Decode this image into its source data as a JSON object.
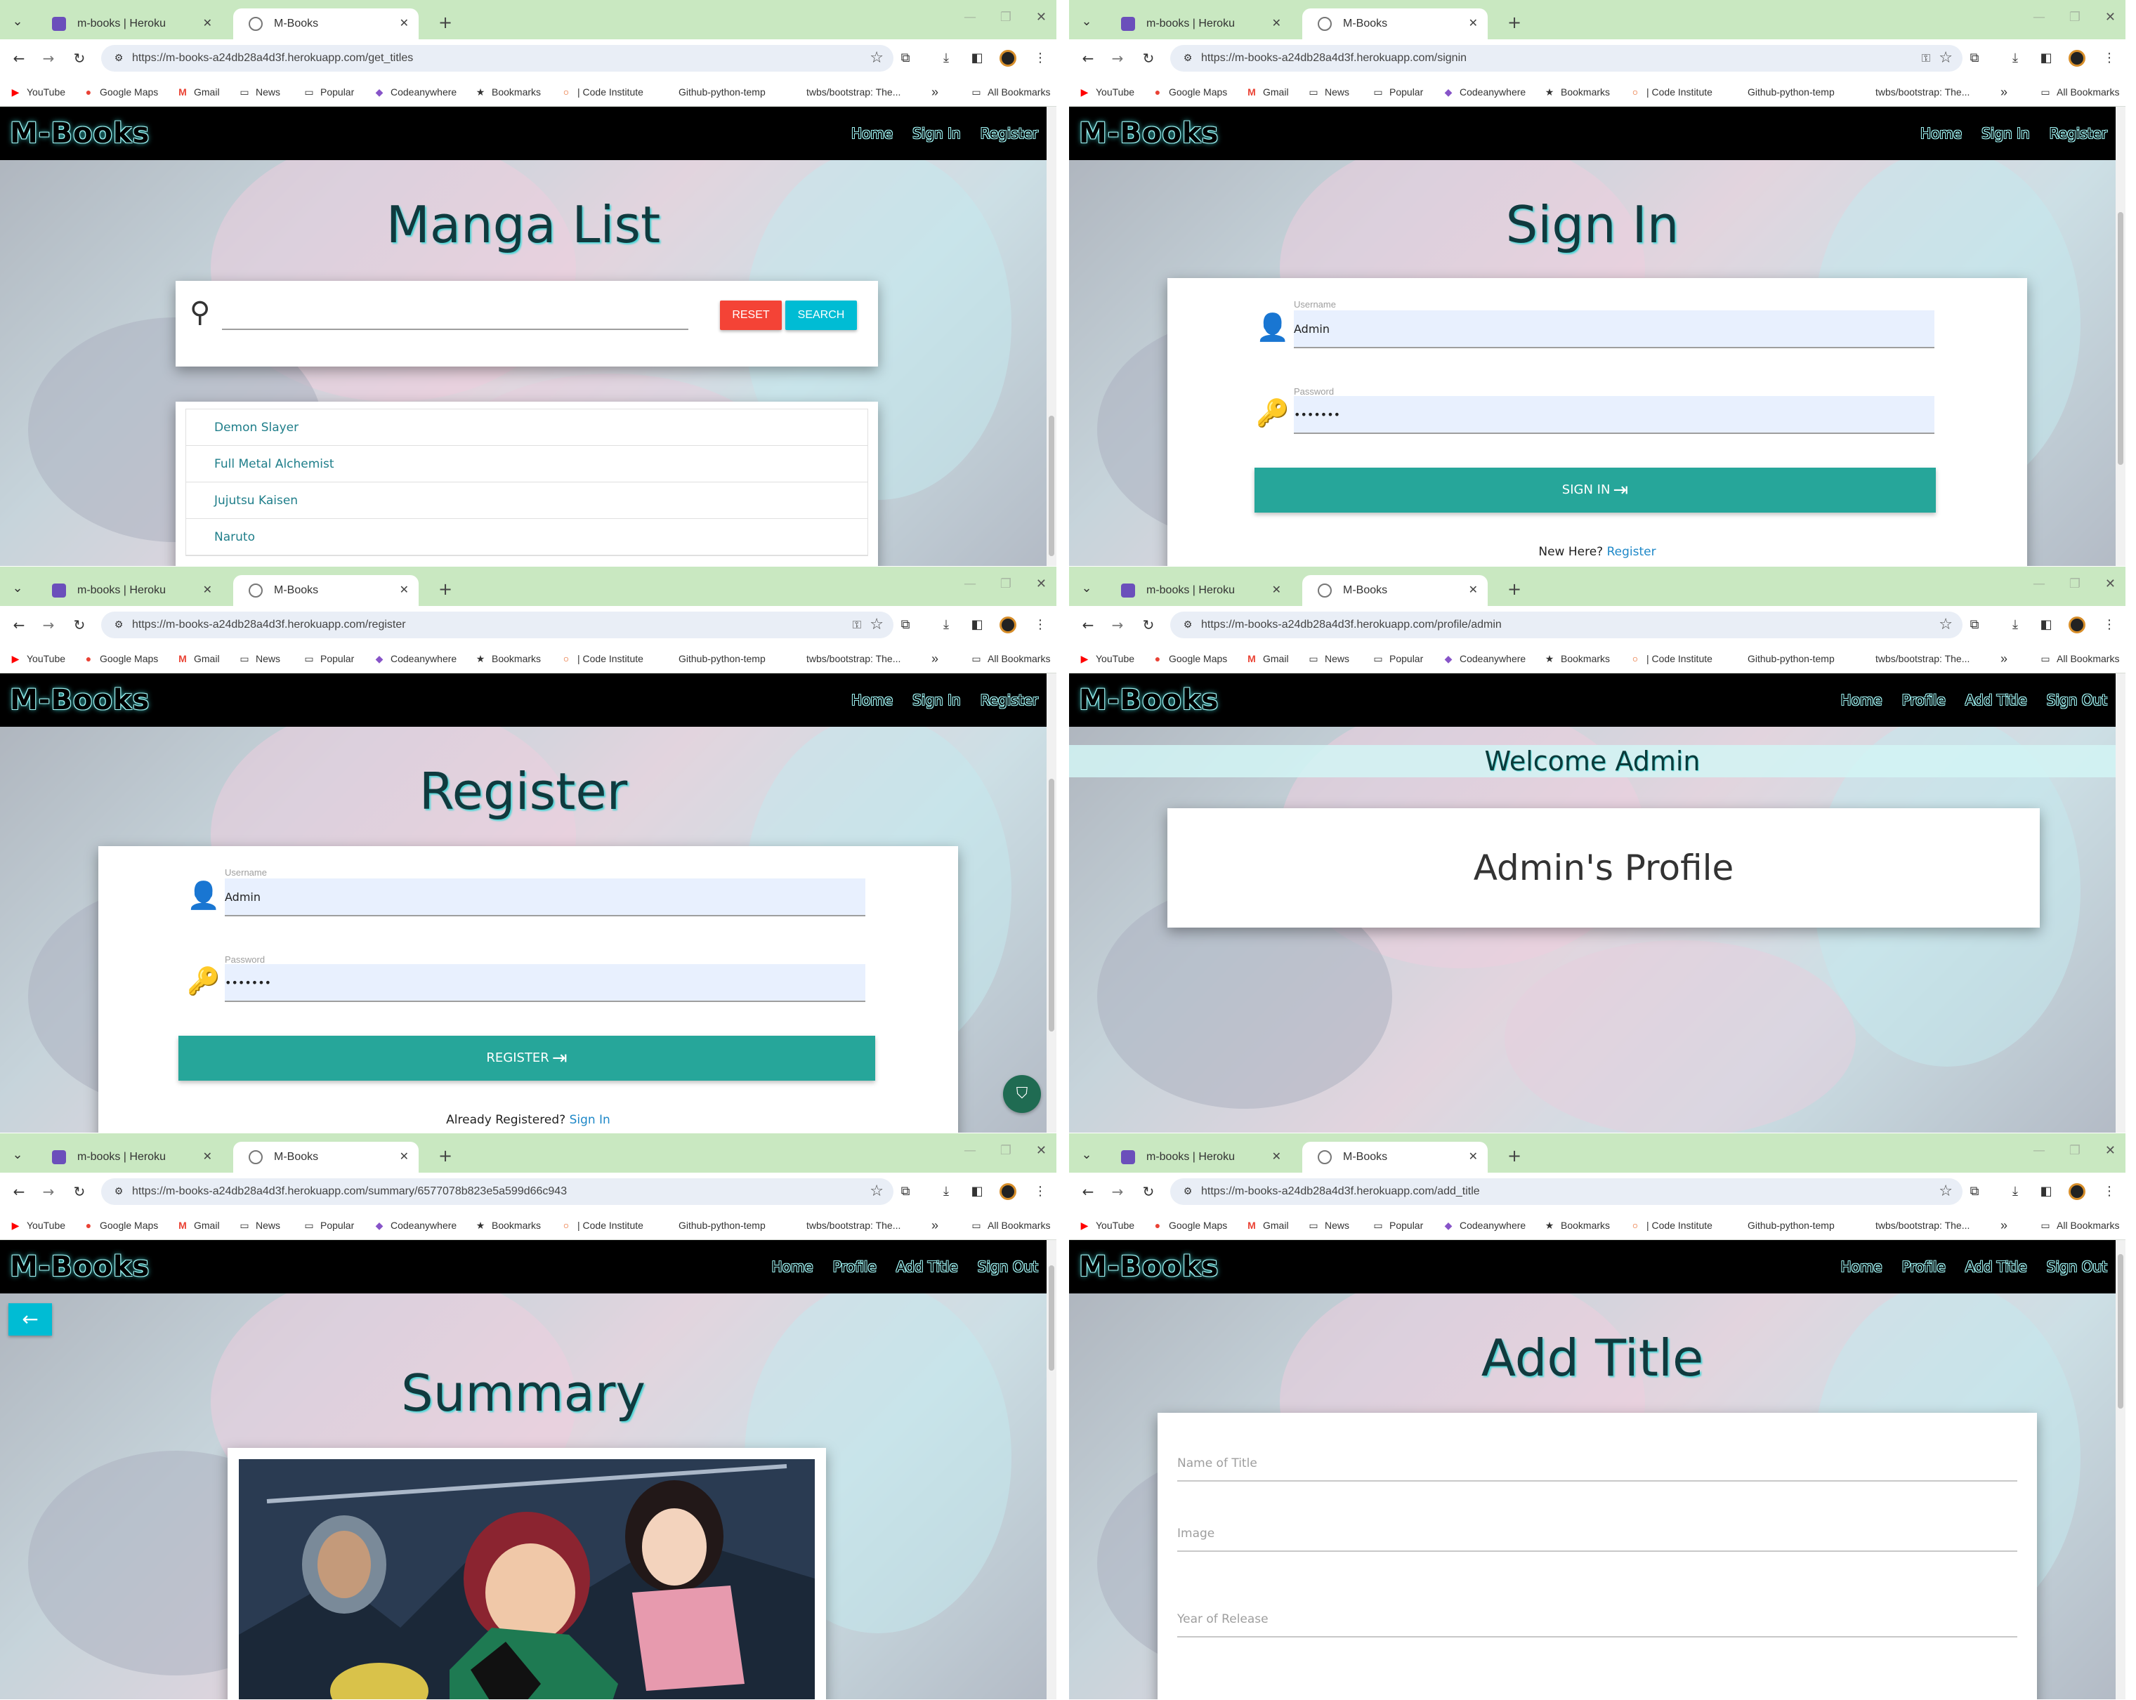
{
  "browser": {
    "tab1_title": "m-books | Heroku",
    "tab2_title": "M-Books",
    "tab_close": "✕",
    "new_tab": "+",
    "bookmarks": [
      "YouTube",
      "Google Maps",
      "Gmail",
      "News",
      "Popular",
      "Codeanywhere",
      "Bookmarks",
      "| Code Institute",
      "Github-python-temp",
      "twbs/bootstrap: The..."
    ],
    "bookmarks_more": "»",
    "all_bookmarks": "All Bookmarks"
  },
  "site": {
    "brand": "M-Books",
    "nav_guest": [
      "Home",
      "Sign In",
      "Register"
    ],
    "nav_user": [
      "Home",
      "Profile",
      "Add Title",
      "Sign Out"
    ]
  },
  "panels": {
    "get_titles": {
      "url": "https://m-books-a24db28a4d3f.herokuapp.com/get_titles",
      "title": "Manga List",
      "reset_label": "RESET",
      "search_label": "SEARCH",
      "titles": [
        "Demon Slayer",
        "Full Metal Alchemist",
        "Jujutsu Kaisen",
        "Naruto"
      ]
    },
    "signin": {
      "url": "https://m-books-a24db28a4d3f.herokuapp.com/signin",
      "title": "Sign In",
      "username_label": "Username",
      "username_value": "Admin",
      "password_label": "Password",
      "password_value": "•••••••",
      "submit_label": "SIGN IN",
      "footer_prefix": "New Here?",
      "footer_link": "Register"
    },
    "register": {
      "url": "https://m-books-a24db28a4d3f.herokuapp.com/register",
      "title": "Register",
      "username_label": "Username",
      "username_value": "Admin",
      "password_label": "Password",
      "password_value": "•••••••",
      "submit_label": "REGISTER",
      "footer_prefix": "Already Registered?",
      "footer_link": "Sign In"
    },
    "profile": {
      "url": "https://m-books-a24db28a4d3f.herokuapp.com/profile/admin",
      "welcome": "Welcome Admin",
      "heading": "Admin's Profile"
    },
    "summary": {
      "url": "https://m-books-a24db28a4d3f.herokuapp.com/summary/6577078b823e5a599d66c943",
      "title": "Summary"
    },
    "add_title": {
      "url": "https://m-books-a24db28a4d3f.herokuapp.com/add_title",
      "title": "Add Title",
      "field_name": "Name of Title",
      "field_image": "Image",
      "field_year": "Year of Release"
    }
  }
}
